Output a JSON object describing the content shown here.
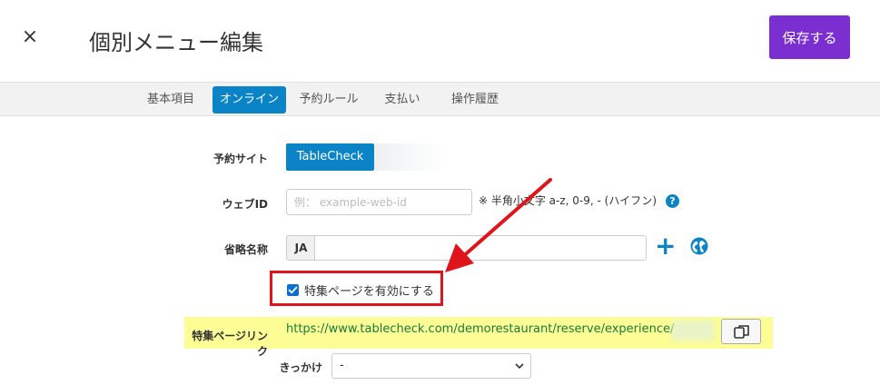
{
  "header": {
    "close": "×",
    "title": "個別メニュー編集",
    "save_label": "保存する"
  },
  "tabs": [
    {
      "label": "基本項目",
      "active": false
    },
    {
      "label": "オンライン",
      "active": true
    },
    {
      "label": "予約ルール",
      "active": false
    },
    {
      "label": "支払い",
      "active": false
    },
    {
      "label": "操作履歴",
      "active": false
    }
  ],
  "form": {
    "site_label": "予約サイト",
    "site_value": "TableCheck",
    "webid_label": "ウェブID",
    "webid_placeholder": "例： example-web-id",
    "webid_hint": "※ 半角小文字 a-z, 0-9, - (ハイフン)",
    "help_glyph": "?",
    "short_name_label": "省略名称",
    "short_name_lang": "JA",
    "short_name_value": "",
    "plus_glyph": "+",
    "feature_checkbox_label": "特集ページを有効にする",
    "feature_checkbox_checked": true,
    "feature_link_label": "特集ページリンク",
    "feature_link_url": "https://www.tablecheck.com/demorestaurant/reserve/experience/",
    "trigger_label": "きっかけ",
    "trigger_value": "-"
  },
  "icons": {
    "close": "close-icon",
    "help": "help-icon",
    "add": "plus-icon",
    "translate": "globe-icon",
    "copy": "copy-icon",
    "checkbox": "check-icon",
    "dropdown": "chevron-down-icon",
    "annotation": "red-arrow"
  },
  "colors": {
    "accent": "#7b2fd0",
    "primary": "#0a84c6",
    "highlight": "#fdfd96",
    "annotation": "#e0151b",
    "link": "#1a7a3a"
  }
}
